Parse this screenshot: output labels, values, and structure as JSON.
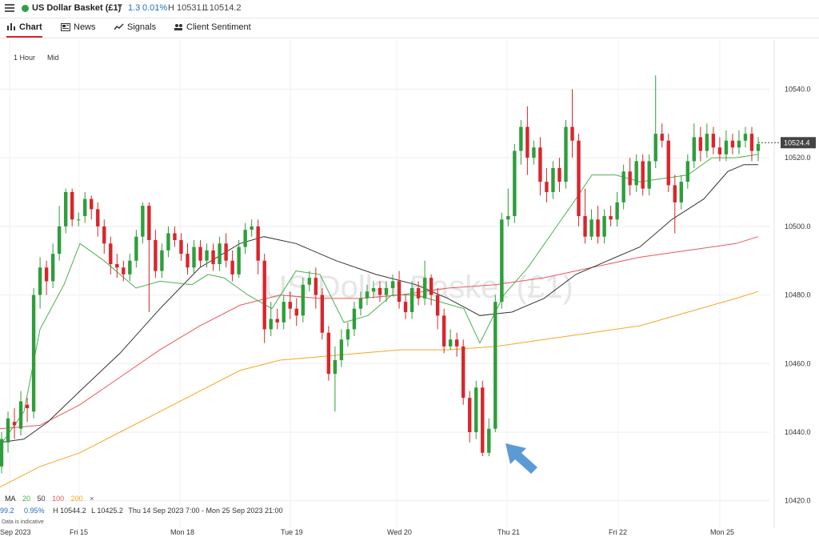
{
  "header": {
    "instrument": "US Dollar Basket (£1)",
    "change": "1.3",
    "change_pct": "0.01%",
    "high": "H 10531.1",
    "low": "L 10514.2"
  },
  "tabs": [
    {
      "label": "Chart",
      "icon": "chart-icon"
    },
    {
      "label": "News",
      "icon": "news-icon"
    },
    {
      "label": "Signals",
      "icon": "signals-icon"
    },
    {
      "label": "Client Sentiment",
      "icon": "sentiment-icon"
    }
  ],
  "timeframe": {
    "interval": "1 Hour",
    "price_type": "Mid"
  },
  "watermark": "US Dollar Basket (£1)",
  "legend": {
    "ma": "MA",
    "periods": [
      {
        "label": "20",
        "color": "#4caf50"
      },
      {
        "label": "50",
        "color": "#333333"
      },
      {
        "label": "100",
        "color": "#e8585b"
      },
      {
        "label": "200",
        "color": "#f5a623"
      }
    ],
    "close": "×"
  },
  "stats": {
    "a": "99.2",
    "b": "0.95%",
    "high": "H 10544.2",
    "low": "L 10425.2",
    "range": "Thu 14 Sep 2023 7:00 - Mon 25 Sep 2023 21:00"
  },
  "indicative": "Data is indicative",
  "current_price": "10524.4",
  "colors": {
    "up": "#2e9e3b",
    "down": "#d8262b",
    "accent": "#d9252a",
    "arrow": "#5b9bd5"
  },
  "chart_data": {
    "type": "candlestick",
    "y_ticks": [
      "10540.0",
      "10520.0",
      "10500.0",
      "10480.0",
      "10460.0",
      "10440.0",
      "10420.0"
    ],
    "x_ticks": [
      "Sep 2023",
      "Fri 15",
      "Mon 18",
      "Tue 19",
      "Wed 20",
      "Thu 21",
      "Fri 22",
      "Mon 25"
    ],
    "ylim": [
      10412,
      10552
    ],
    "candles": [
      [
        10430,
        10438,
        10428,
        10440
      ],
      [
        10437,
        10444,
        10434,
        10446
      ],
      [
        10443,
        10442,
        10438,
        10447
      ],
      [
        10441,
        10449,
        10439,
        10452
      ],
      [
        10448,
        10447,
        10443,
        10450
      ],
      [
        10446,
        10480,
        10444,
        10482
      ],
      [
        10480,
        10488,
        10476,
        10491
      ],
      [
        10488,
        10484,
        10480,
        10490
      ],
      [
        10484,
        10492,
        10482,
        10495
      ],
      [
        10492,
        10500,
        10490,
        10506
      ],
      [
        10500,
        10510,
        10498,
        10511
      ],
      [
        10510,
        10502,
        10500,
        10511
      ],
      [
        10502,
        10502,
        10500,
        10504
      ],
      [
        10503,
        10508,
        10501,
        10510
      ],
      [
        10508,
        10505,
        10502,
        10509
      ],
      [
        10505,
        10500,
        10497,
        10507
      ],
      [
        10500,
        10495,
        10492,
        10502
      ],
      [
        10495,
        10489,
        10486,
        10497
      ],
      [
        10489,
        10488,
        10485,
        10492
      ],
      [
        10488,
        10486,
        10484,
        10490
      ],
      [
        10486,
        10490,
        10484,
        10492
      ],
      [
        10490,
        10497,
        10488,
        10499
      ],
      [
        10497,
        10506,
        10495,
        10507
      ],
      [
        10506,
        10496,
        10475,
        10507
      ],
      [
        10496,
        10487,
        10485,
        10499
      ],
      [
        10487,
        10493,
        10485,
        10495
      ],
      [
        10493,
        10498,
        10491,
        10500
      ],
      [
        10498,
        10496,
        10494,
        10500
      ],
      [
        10496,
        10492,
        10490,
        10498
      ],
      [
        10492,
        10488,
        10486,
        10495
      ],
      [
        10488,
        10494,
        10486,
        10496
      ],
      [
        10494,
        10490,
        10488,
        10496
      ],
      [
        10490,
        10493,
        10488,
        10495
      ],
      [
        10493,
        10489,
        10487,
        10495
      ],
      [
        10489,
        10495,
        10487,
        10497
      ],
      [
        10495,
        10490,
        10488,
        10498
      ],
      [
        10490,
        10486,
        10484,
        10493
      ],
      [
        10486,
        10494,
        10485,
        10496
      ],
      [
        10494,
        10499,
        10492,
        10501
      ],
      [
        10499,
        10500,
        10497,
        10502
      ],
      [
        10500,
        10490,
        10486,
        10502
      ],
      [
        10490,
        10470,
        10466,
        10492
      ],
      [
        10470,
        10473,
        10468,
        10478
      ],
      [
        10473,
        10472,
        10470,
        10476
      ],
      [
        10472,
        10478,
        10470,
        10480
      ],
      [
        10478,
        10476,
        10473,
        10481
      ],
      [
        10476,
        10474,
        10471,
        10479
      ],
      [
        10474,
        10483,
        10472,
        10485
      ],
      [
        10483,
        10485,
        10481,
        10487
      ],
      [
        10485,
        10480,
        10476,
        10488
      ],
      [
        10480,
        10469,
        10467,
        10482
      ],
      [
        10469,
        10457,
        10455,
        10471
      ],
      [
        10457,
        10461,
        10446,
        10465
      ],
      [
        10461,
        10467,
        10459,
        10470
      ],
      [
        10467,
        10470,
        10465,
        10472
      ],
      [
        10470,
        10476,
        10468,
        10478
      ],
      [
        10476,
        10479,
        10474,
        10481
      ],
      [
        10479,
        10481,
        10477,
        10483
      ],
      [
        10481,
        10482,
        10479,
        10484
      ],
      [
        10482,
        10480,
        10478,
        10484
      ],
      [
        10480,
        10482,
        10478,
        10484
      ],
      [
        10482,
        10484,
        10480,
        10486
      ],
      [
        10484,
        10478,
        10476,
        10487
      ],
      [
        10478,
        10475,
        10473,
        10480
      ],
      [
        10475,
        10482,
        10473,
        10484
      ],
      [
        10482,
        10479,
        10477,
        10484
      ],
      [
        10479,
        10485,
        10477,
        10490
      ],
      [
        10485,
        10480,
        10477,
        10486
      ],
      [
        10480,
        10474,
        10470,
        10482
      ],
      [
        10474,
        10465,
        10463,
        10476
      ],
      [
        10465,
        10467,
        10464,
        10470
      ],
      [
        10467,
        10465,
        10462,
        10469
      ],
      [
        10465,
        10450,
        10448,
        10467
      ],
      [
        10450,
        10440,
        10437,
        10452
      ],
      [
        10440,
        10453,
        10438,
        10455
      ],
      [
        10453,
        10434,
        10433,
        10455
      ],
      [
        10434,
        10441,
        10433,
        10444
      ],
      [
        10441,
        10478,
        10440,
        10480
      ],
      [
        10478,
        10502,
        10476,
        10504
      ],
      [
        10502,
        10503,
        10500,
        10511
      ],
      [
        10503,
        10522,
        10501,
        10524
      ],
      [
        10522,
        10529,
        10518,
        10531
      ],
      [
        10529,
        10520,
        10515,
        10535
      ],
      [
        10520,
        10523,
        10518,
        10525
      ],
      [
        10523,
        10513,
        10509,
        10526
      ],
      [
        10513,
        10510,
        10507,
        10517
      ],
      [
        10510,
        10517,
        10508,
        10519
      ],
      [
        10517,
        10513,
        10510,
        10520
      ],
      [
        10513,
        10529,
        10511,
        10531
      ],
      [
        10529,
        10525,
        10520,
        10540
      ],
      [
        10525,
        10503,
        10500,
        10527
      ],
      [
        10503,
        10497,
        10495,
        10511
      ],
      [
        10497,
        10502,
        10496,
        10505
      ],
      [
        10502,
        10497,
        10495,
        10506
      ],
      [
        10497,
        10503,
        10495,
        10505
      ],
      [
        10503,
        10502,
        10500,
        10506
      ],
      [
        10502,
        10507,
        10500,
        10510
      ],
      [
        10507,
        10516,
        10505,
        10518
      ],
      [
        10516,
        10512,
        10509,
        10520
      ],
      [
        10512,
        10519,
        10510,
        10521
      ],
      [
        10519,
        10511,
        10509,
        10521
      ],
      [
        10511,
        10519,
        10509,
        10521
      ],
      [
        10519,
        10527,
        10517,
        10544
      ],
      [
        10527,
        10525,
        10523,
        10530
      ],
      [
        10525,
        10512,
        10510,
        10527
      ],
      [
        10512,
        10507,
        10498,
        10515
      ],
      [
        10507,
        10513,
        10505,
        10515
      ],
      [
        10513,
        10519,
        10511,
        10521
      ],
      [
        10519,
        10526,
        10517,
        10530
      ],
      [
        10526,
        10522,
        10519,
        10529
      ],
      [
        10522,
        10527,
        10520,
        10530
      ],
      [
        10527,
        10523,
        10521,
        10529
      ],
      [
        10523,
        10521,
        10519,
        10526
      ],
      [
        10521,
        10525,
        10519,
        10528
      ],
      [
        10525,
        10523,
        10521,
        10527
      ],
      [
        10523,
        10525,
        10521,
        10528
      ],
      [
        10525,
        10527,
        10523,
        10529
      ],
      [
        10527,
        10522,
        10519,
        10529
      ],
      [
        10522,
        10524,
        10519,
        10526
      ]
    ],
    "ma20": [
      [
        0,
        10436
      ],
      [
        30,
        10446
      ],
      [
        50,
        10470
      ],
      [
        80,
        10483
      ],
      [
        100,
        10495
      ],
      [
        130,
        10490
      ],
      [
        170,
        10482
      ],
      [
        200,
        10484
      ],
      [
        240,
        10483
      ],
      [
        260,
        10486
      ],
      [
        280,
        10485
      ],
      [
        310,
        10480
      ],
      [
        340,
        10476
      ],
      [
        370,
        10487
      ],
      [
        400,
        10486
      ],
      [
        430,
        10472
      ],
      [
        460,
        10474
      ],
      [
        490,
        10480
      ],
      [
        520,
        10480
      ],
      [
        550,
        10478
      ],
      [
        580,
        10476
      ],
      [
        600,
        10466
      ],
      [
        630,
        10480
      ],
      [
        660,
        10488
      ],
      [
        690,
        10498
      ],
      [
        720,
        10508
      ],
      [
        740,
        10515
      ],
      [
        770,
        10515
      ],
      [
        800,
        10513
      ],
      [
        830,
        10514
      ],
      [
        860,
        10515
      ],
      [
        890,
        10520
      ],
      [
        920,
        10520
      ],
      [
        948,
        10521
      ]
    ],
    "ma50": [
      [
        0,
        10437
      ],
      [
        30,
        10438
      ],
      [
        60,
        10443
      ],
      [
        100,
        10452
      ],
      [
        150,
        10463
      ],
      [
        200,
        10476
      ],
      [
        250,
        10488
      ],
      [
        300,
        10495
      ],
      [
        330,
        10497
      ],
      [
        370,
        10495
      ],
      [
        420,
        10490
      ],
      [
        470,
        10486
      ],
      [
        520,
        10483
      ],
      [
        560,
        10479
      ],
      [
        600,
        10474
      ],
      [
        640,
        10475
      ],
      [
        680,
        10479
      ],
      [
        720,
        10486
      ],
      [
        760,
        10490
      ],
      [
        800,
        10494
      ],
      [
        840,
        10502
      ],
      [
        880,
        10508
      ],
      [
        910,
        10516
      ],
      [
        930,
        10518
      ],
      [
        948,
        10518
      ]
    ],
    "ma100": [
      [
        0,
        10441
      ],
      [
        50,
        10442
      ],
      [
        100,
        10448
      ],
      [
        150,
        10456
      ],
      [
        200,
        10464
      ],
      [
        250,
        10471
      ],
      [
        300,
        10477
      ],
      [
        350,
        10480
      ],
      [
        400,
        10479
      ],
      [
        450,
        10479
      ],
      [
        500,
        10480
      ],
      [
        560,
        10482
      ],
      [
        620,
        10483
      ],
      [
        680,
        10485
      ],
      [
        740,
        10488
      ],
      [
        800,
        10491
      ],
      [
        860,
        10493
      ],
      [
        920,
        10495
      ],
      [
        948,
        10497
      ]
    ],
    "ma200": [
      [
        0,
        10424
      ],
      [
        50,
        10430
      ],
      [
        100,
        10434
      ],
      [
        150,
        10440
      ],
      [
        200,
        10446
      ],
      [
        250,
        10452
      ],
      [
        300,
        10458
      ],
      [
        350,
        10461
      ],
      [
        400,
        10462
      ],
      [
        450,
        10463
      ],
      [
        500,
        10464
      ],
      [
        560,
        10464
      ],
      [
        620,
        10465
      ],
      [
        680,
        10467
      ],
      [
        740,
        10469
      ],
      [
        800,
        10471
      ],
      [
        860,
        10475
      ],
      [
        920,
        10479
      ],
      [
        948,
        10481
      ]
    ]
  }
}
